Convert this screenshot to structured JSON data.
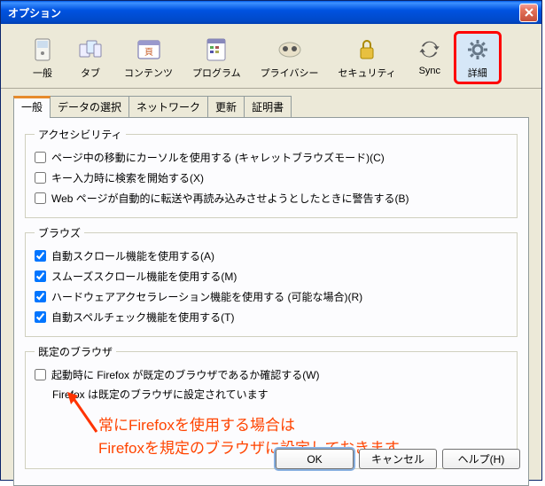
{
  "window": {
    "title": "オプション"
  },
  "toolbar": {
    "items": [
      {
        "label": "一般",
        "icon": "general"
      },
      {
        "label": "タブ",
        "icon": "tabs"
      },
      {
        "label": "コンテンツ",
        "icon": "content"
      },
      {
        "label": "プログラム",
        "icon": "programs"
      },
      {
        "label": "プライバシー",
        "icon": "privacy"
      },
      {
        "label": "セキュリティ",
        "icon": "security"
      },
      {
        "label": "Sync",
        "icon": "sync"
      },
      {
        "label": "詳細",
        "icon": "advanced"
      }
    ]
  },
  "tabs": {
    "items": [
      {
        "label": "一般"
      },
      {
        "label": "データの選択"
      },
      {
        "label": "ネットワーク"
      },
      {
        "label": "更新"
      },
      {
        "label": "証明書"
      }
    ]
  },
  "groups": {
    "accessibility": {
      "legend": "アクセシビリティ",
      "items": [
        {
          "label": "ページ中の移動にカーソルを使用する (キャレットブラウズモード)(C)",
          "checked": false
        },
        {
          "label": "キー入力時に検索を開始する(X)",
          "checked": false
        },
        {
          "label": "Web ページが自動的に転送や再読み込みさせようとしたときに警告する(B)",
          "checked": false
        }
      ]
    },
    "browse": {
      "legend": "ブラウズ",
      "items": [
        {
          "label": "自動スクロール機能を使用する(A)",
          "checked": true
        },
        {
          "label": "スムーズスクロール機能を使用する(M)",
          "checked": true
        },
        {
          "label": "ハードウェアアクセラレーション機能を使用する (可能な場合)(R)",
          "checked": true
        },
        {
          "label": "自動スペルチェック機能を使用する(T)",
          "checked": true
        }
      ]
    },
    "default_browser": {
      "legend": "既定のブラウザ",
      "check_label": "起動時に Firefox が既定のブラウザであるか確認する(W)",
      "checked": false,
      "status": "Firefox は既定のブラウザに設定されています"
    }
  },
  "annotation": {
    "line1": "常にFirefoxを使用する場合は",
    "line2": "Firefoxを規定のブラウザに設定しておきます"
  },
  "buttons": {
    "ok": "OK",
    "cancel": "キャンセル",
    "help": "ヘルプ(H)"
  }
}
